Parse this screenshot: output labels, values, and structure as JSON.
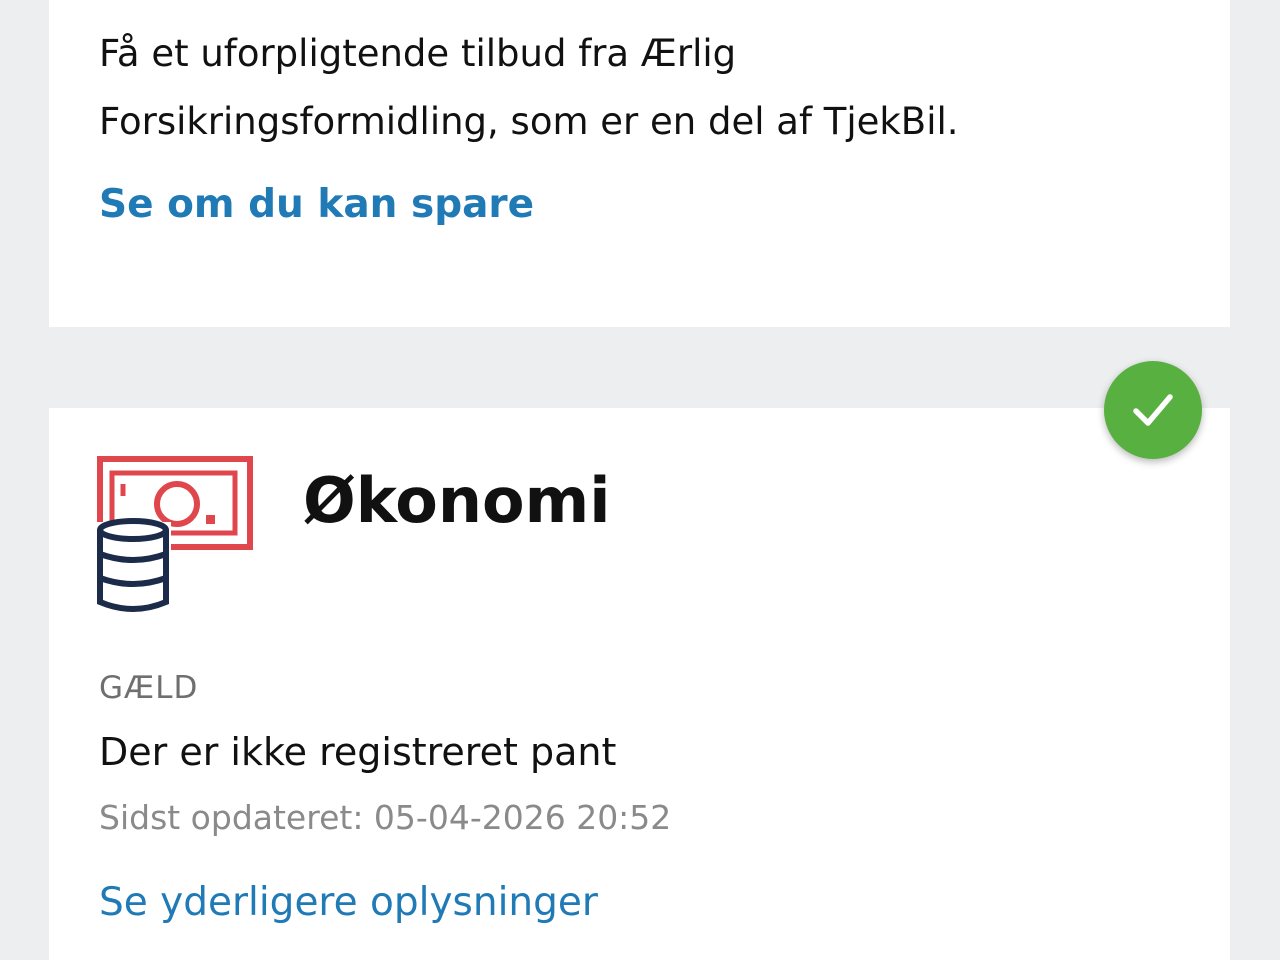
{
  "insurance_card": {
    "offer_text": "Få et uforpligtende tilbud fra Ærlig Forsikringsformidling, som er en del af TjekBil.",
    "save_link": "Se om du kan spare"
  },
  "economy_card": {
    "title": "Økonomi",
    "icon": "money-coins-icon",
    "status_badge_icon": "check-icon",
    "category_label": "GÆLD",
    "status_text": "Der er ikke registreret pant",
    "updated_text": "Sidst opdateret: 05-04-2026 20:52",
    "details_link": "Se yderligere oplysninger"
  },
  "colors": {
    "link": "#1f7ab5",
    "success": "#58b041",
    "icon_red": "#e0474c",
    "icon_navy": "#1c2b4a",
    "background": "#eceef0"
  }
}
